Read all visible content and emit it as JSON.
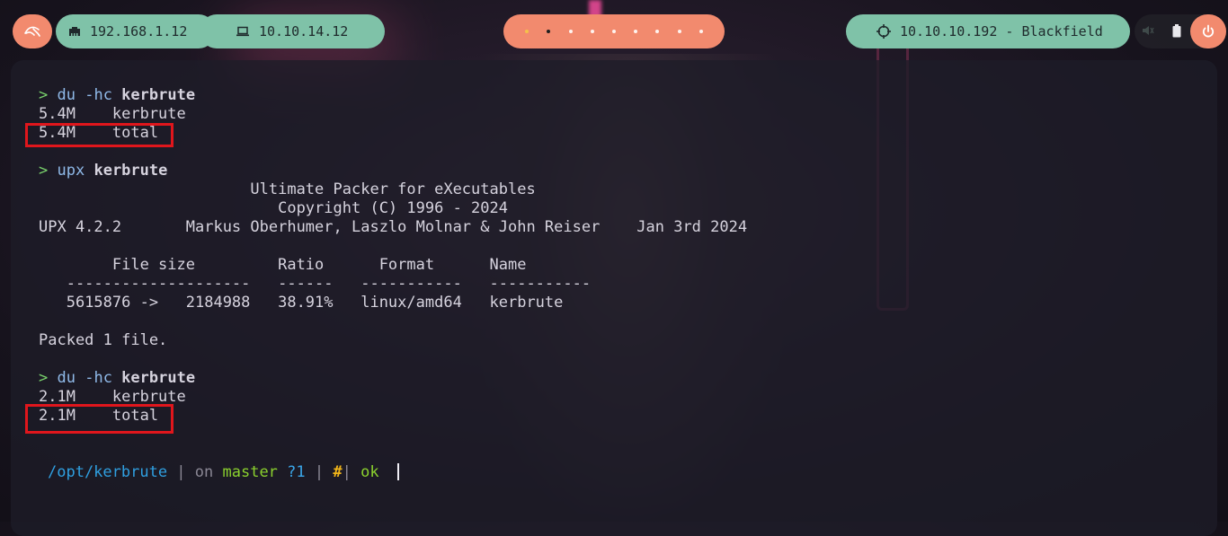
{
  "topbar": {
    "ip_local": "192.168.1.12",
    "ip_vpn": "10.10.14.12",
    "target": "10.10.10.192 - Blackfield",
    "workspaces_count": 9,
    "active_workspace": 2
  },
  "terminal": {
    "lines": [
      {
        "prompt": ">",
        "cmd": "du",
        "args": " -hc ",
        "target": "kerbrute"
      },
      {
        "text": "5.4M    kerbrute"
      },
      {
        "text": "5.4M    total"
      },
      {
        "prompt": ">",
        "cmd": "upx",
        "args": " ",
        "target": "kerbrute"
      },
      {
        "text": "                       Ultimate Packer for eXecutables"
      },
      {
        "text": "                          Copyright (C) 1996 - 2024"
      },
      {
        "text": "UPX 4.2.2       Markus Oberhumer, Laszlo Molnar & John Reiser    Jan 3rd 2024"
      },
      {
        "text": "        File size         Ratio      Format      Name"
      },
      {
        "text": "   --------------------   ------   -----------   -----------"
      },
      {
        "text": "   5615876 ->   2184988   38.91%   linux/amd64   kerbrute"
      },
      {
        "text": "Packed 1 file."
      },
      {
        "prompt": ">",
        "cmd": "du",
        "args": " -hc ",
        "target": "kerbrute"
      },
      {
        "text": "2.1M    kerbrute"
      },
      {
        "text": "2.1M    total"
      }
    ]
  },
  "statusline": {
    "path": "/opt/kerbrute",
    "sep1": " | ",
    "on": "on ",
    "branch": "master",
    "status": " ?1",
    "sep2": " | ",
    "hash": "#",
    "sep3": "| ",
    "ok": "ok"
  },
  "colors": {
    "accent_orange": "#f28a6e",
    "accent_teal": "#7fc2a8",
    "highlight_red": "#e0161c",
    "prompt_green": "#79d26c"
  }
}
